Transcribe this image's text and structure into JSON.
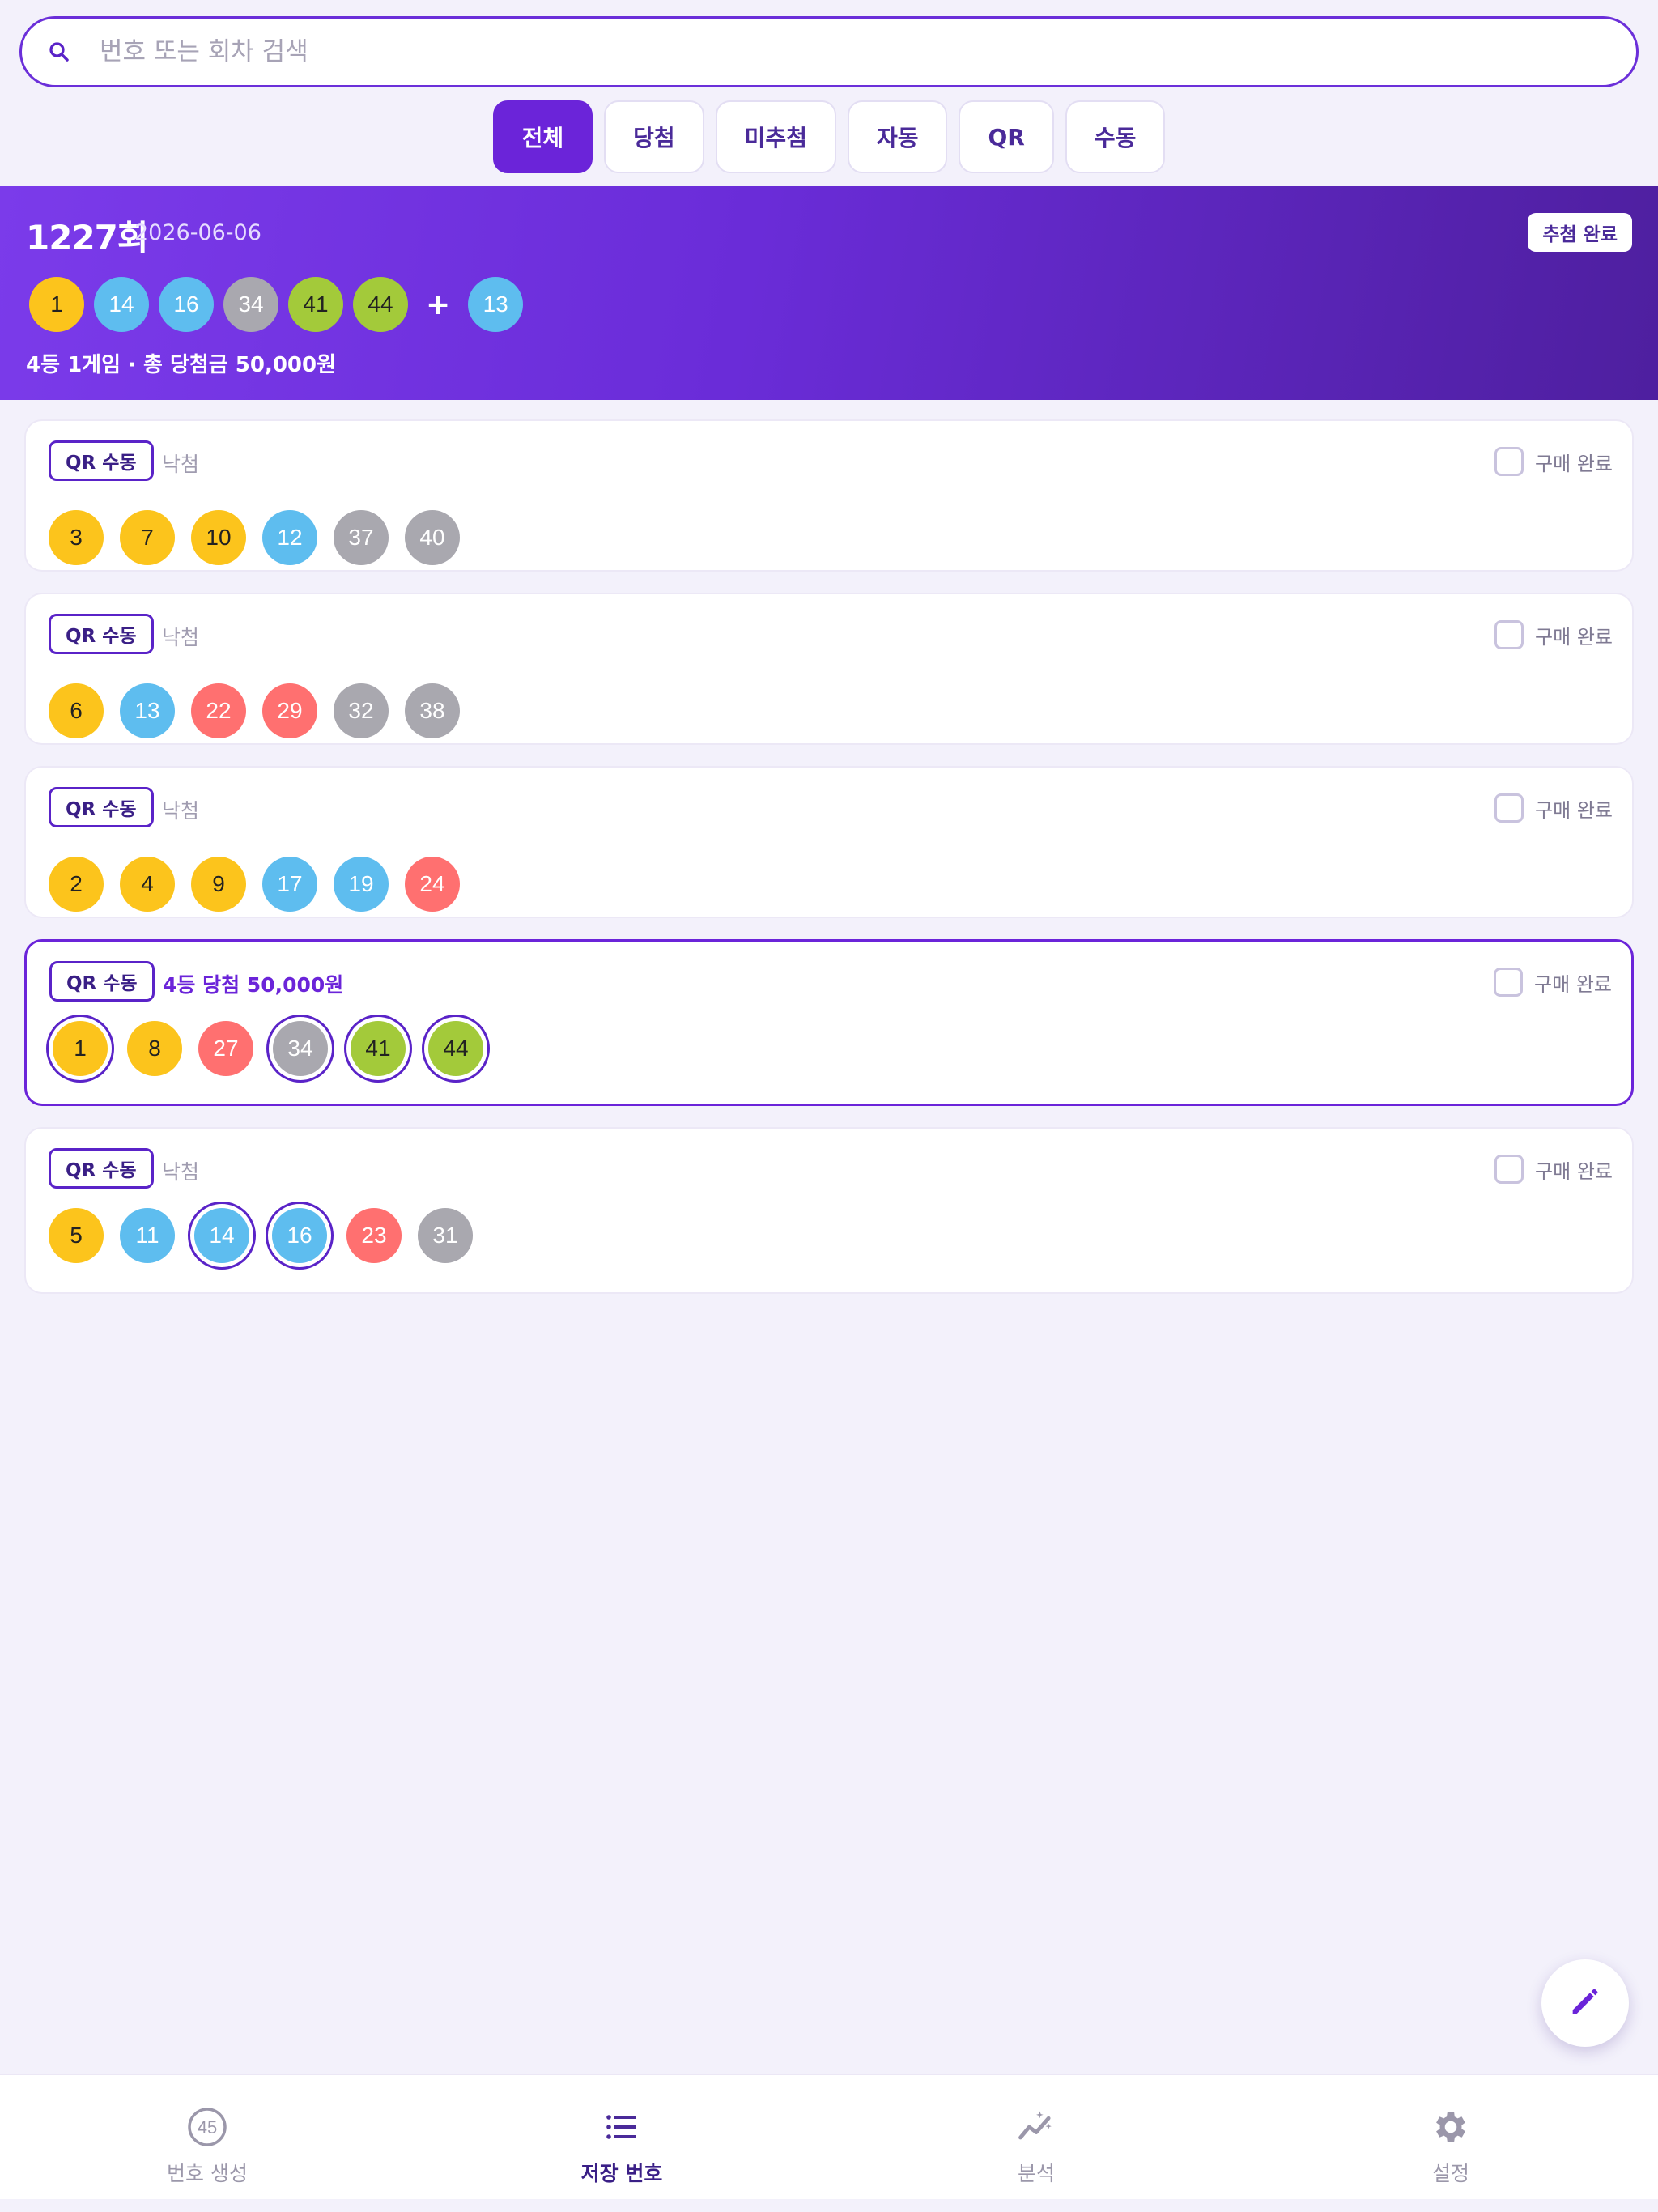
{
  "search": {
    "placeholder": "번호 또는 회차 검색"
  },
  "filters": [
    "전체",
    "당첨",
    "미추첨",
    "자동",
    "QR",
    "수동"
  ],
  "banner": {
    "round": "1227회",
    "date": "2026-06-06",
    "badge": "추첨 완료",
    "numbers": [
      1,
      14,
      16,
      34,
      41,
      44
    ],
    "bonus": 13,
    "plus": "+",
    "summary": "4등 1게임 · 총 당첨금 50,000원"
  },
  "cards": [
    {
      "tag": "QR 수동",
      "status": "낙첨",
      "purchase": "구매 완료",
      "numbers": [
        3,
        7,
        10,
        12,
        37,
        40
      ]
    },
    {
      "tag": "QR 수동",
      "status": "낙첨",
      "purchase": "구매 완료",
      "numbers": [
        6,
        13,
        22,
        29,
        32,
        38
      ]
    },
    {
      "tag": "QR 수동",
      "status": "낙첨",
      "purchase": "구매 완료",
      "numbers": [
        2,
        4,
        9,
        17,
        19,
        24
      ]
    },
    {
      "tag": "QR 수동",
      "status": "4등 당첨 50,000원",
      "purchase": "구매 완료",
      "numbers": [
        1,
        8,
        27,
        34,
        41,
        44
      ]
    },
    {
      "tag": "QR 수동",
      "status": "낙첨",
      "purchase": "구매 완료",
      "numbers": [
        5,
        11,
        14,
        16,
        23,
        31
      ]
    }
  ],
  "fab": {
    "icon": "pencil-icon"
  },
  "nav": [
    {
      "label": "번호 생성",
      "icon": "circle-45-icon"
    },
    {
      "label": "저장 번호",
      "icon": "list-icon"
    },
    {
      "label": "분석",
      "icon": "sparkle-chart-icon"
    },
    {
      "label": "설정",
      "icon": "gear-icon"
    }
  ],
  "colors": {
    "accent": "#6B24D9",
    "ball_yellow": "#FCC41C",
    "ball_blue": "#5EBDEF",
    "ball_red": "#FF7070",
    "ball_gray": "#A9A8AF",
    "ball_green": "#A3CA3A"
  }
}
